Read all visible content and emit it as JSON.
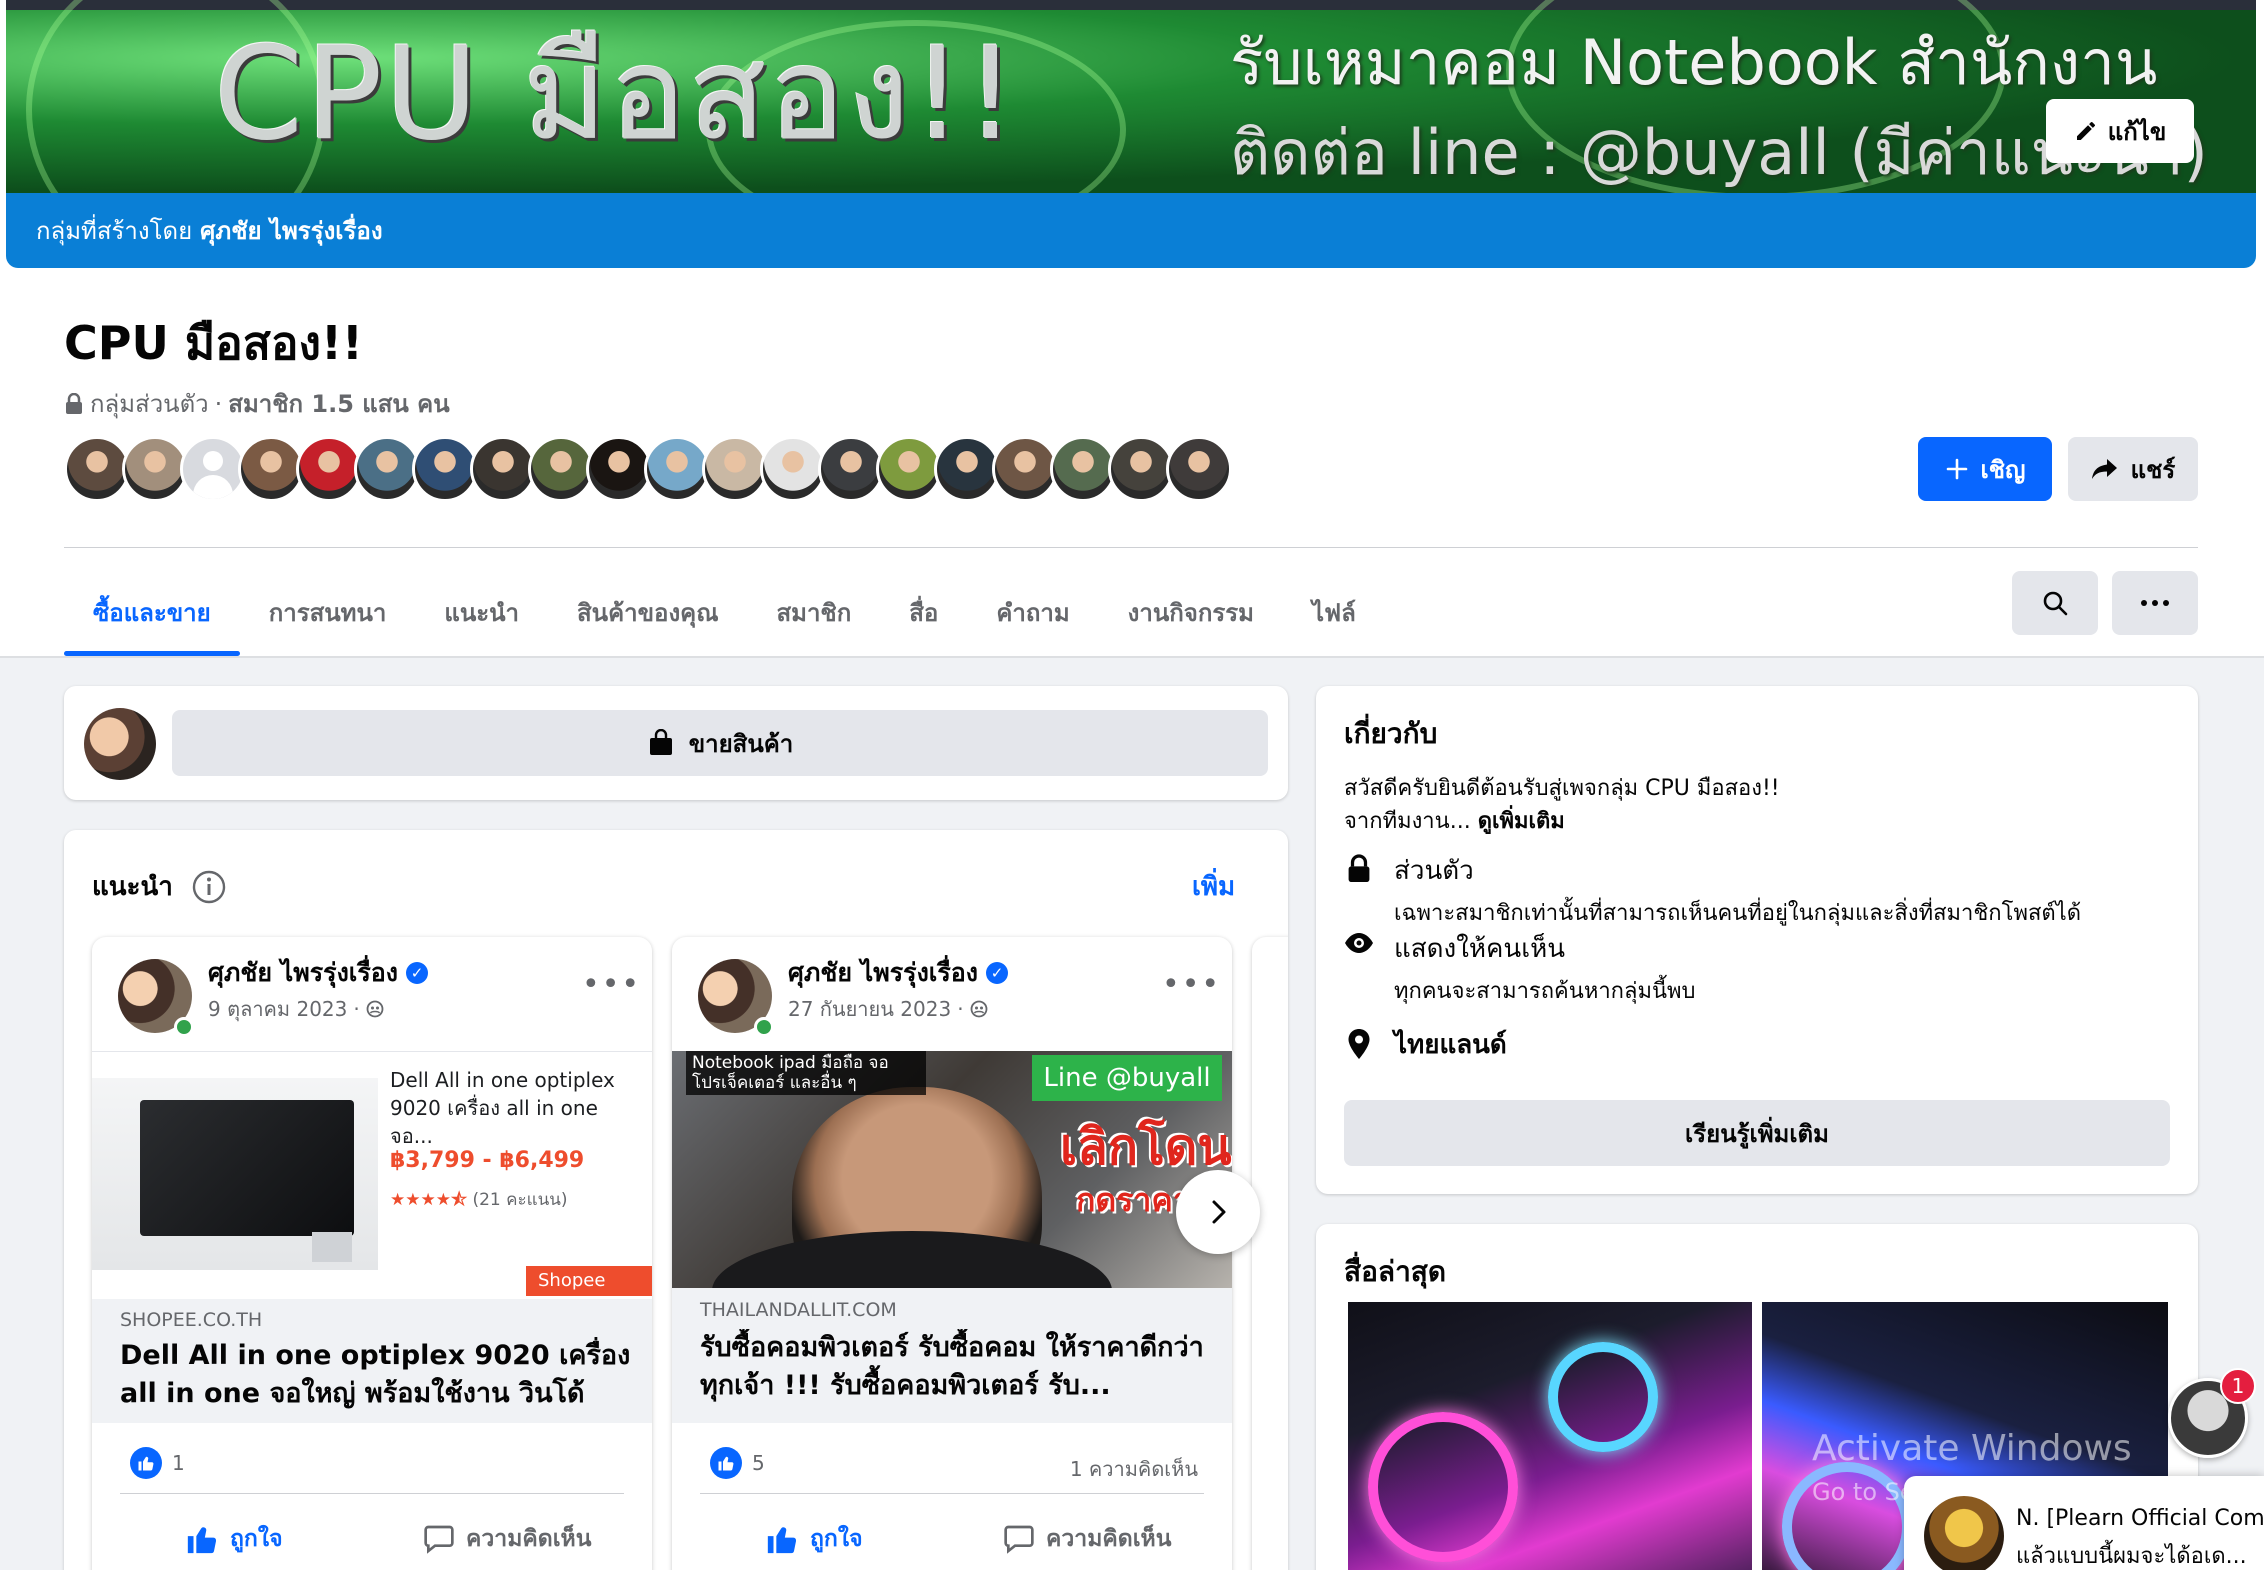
{
  "cover": {
    "big_text": "CPU มือสอง!!",
    "line1": "รับเหมาคอม Notebook สำนักงาน",
    "line2": "ติดต่อ line : @buyall (มีค่าแนะนำ)",
    "edit_label": "แก้ไข",
    "created_by_prefix": "กลุ่มที่สร้างโดย",
    "created_by_name": "ศุภชัย ไพรรุ่งเรื่อง",
    "band_color": "#0a7fd6"
  },
  "group": {
    "title": "CPU มือสอง!!",
    "privacy": "กลุ่มส่วนตัว",
    "separator": "·",
    "members": "สมาชิก 1.5 แสน คน",
    "invite_label": "เชิญ",
    "share_label": "แชร์"
  },
  "member_avatars": [
    "#5d4b3f",
    "#a28f7c",
    "placeholder",
    "#7b5a44",
    "#c5202a",
    "#4b6f86",
    "#2f4e74",
    "#3a3530",
    "#56663c",
    "#1a1512",
    "#76a8c9",
    "#c9b8a4",
    "#e3e3e3",
    "#3b3d40",
    "#7e9b3e",
    "#28343e",
    "#6e5645",
    "#556b4f",
    "#45423c",
    "#3f3b3a"
  ],
  "tabs": [
    {
      "label": "ซื้อและขาย",
      "active": true
    },
    {
      "label": "การสนทนา",
      "active": false
    },
    {
      "label": "แนะนำ",
      "active": false
    },
    {
      "label": "สินค้าของคุณ",
      "active": false
    },
    {
      "label": "สมาชิก",
      "active": false
    },
    {
      "label": "สื่อ",
      "active": false
    },
    {
      "label": "คำถาม",
      "active": false
    },
    {
      "label": "งานกิจกรรม",
      "active": false
    },
    {
      "label": "ไฟล์",
      "active": false
    }
  ],
  "sell": {
    "button_label": "ขายสินค้า"
  },
  "featured": {
    "title": "แนะนำ",
    "more_label": "เพิ่ม",
    "posts": [
      {
        "author": "ศุภชัย ไพรรุ่งเรื่อง",
        "date": "9 ตุลาคม 2023",
        "product_text": "Dell All in one optiplex 9020 เครื่อง all in one จอ...",
        "price": "฿3,799 - ฿6,499",
        "stars": "★★★★⯪",
        "rating_count": "(21 คะแนน)",
        "shop_badge": "Shopee",
        "domain": "SHOPEE.CO.TH",
        "headline": "Dell All in one optiplex 9020 เครื่อง all in one จอใหญ่ พร้อมใช้งาน วินโด้แท้...",
        "likes": "1",
        "comments": "",
        "like_label": "ถูกใจ",
        "comment_label": "ความคิดเห็น"
      },
      {
        "author": "ศุภชัย ไพรรุ่งเรื่อง",
        "date": "27 กันยายน 2023",
        "video_caption": "Notebook ipad มือถือ จอ โปรเจ็คเตอร์ และอื่น ๆ",
        "video_line": "Line @buyall",
        "video_red1": "เลิกโดน",
        "video_red2": "กดราคา",
        "domain": "THAILANDALLIT.COM",
        "headline": "รับซื้อคอมพิวเตอร์ รับซื้อคอม ให้ราคาดีกว่าทุกเจ้า !!! รับซื้อคอมพิวเตอร์ รับ...",
        "likes": "5",
        "comments": "1 ความคิดเห็น",
        "like_label": "ถูกใจ",
        "comment_label": "ความคิดเห็น"
      }
    ]
  },
  "about": {
    "title": "เกี่ยวกับ",
    "desc_line1": "สวัสดีครับยินดีต้อนรับสู่เพจกลุ่ม CPU มือสอง!!",
    "desc_line2": "จากทีมงาน...",
    "see_more": "ดูเพิ่มเติม",
    "private_title": "ส่วนตัว",
    "private_desc": "เฉพาะสมาชิกเท่านั้นที่สามารถเห็นคนที่อยู่ในกลุ่มและสิ่งที่สมาชิกโพสต์ได้",
    "visible_title": "แสดงให้คนเห็น",
    "visible_desc": "ทุกคนจะสามารถค้นหากลุ่มนี้พบ",
    "location": "ไทยแลนด์",
    "learn_more": "เรียนรู้เพิ่มเติม"
  },
  "media": {
    "title": "สื่อล่าสุด"
  },
  "watermark": {
    "line1": "Activate Windows",
    "line2": "Go to Settings to activate Windows."
  },
  "chat": {
    "badge": "1",
    "toast_name": "N. [Plearn Official Community]",
    "toast_msg": "แล้วแบบนี้ผมจะได้อเด..."
  },
  "colors": {
    "accent": "#0866ff",
    "like": "#0866ff",
    "page_bg": "#f0f2f5"
  }
}
